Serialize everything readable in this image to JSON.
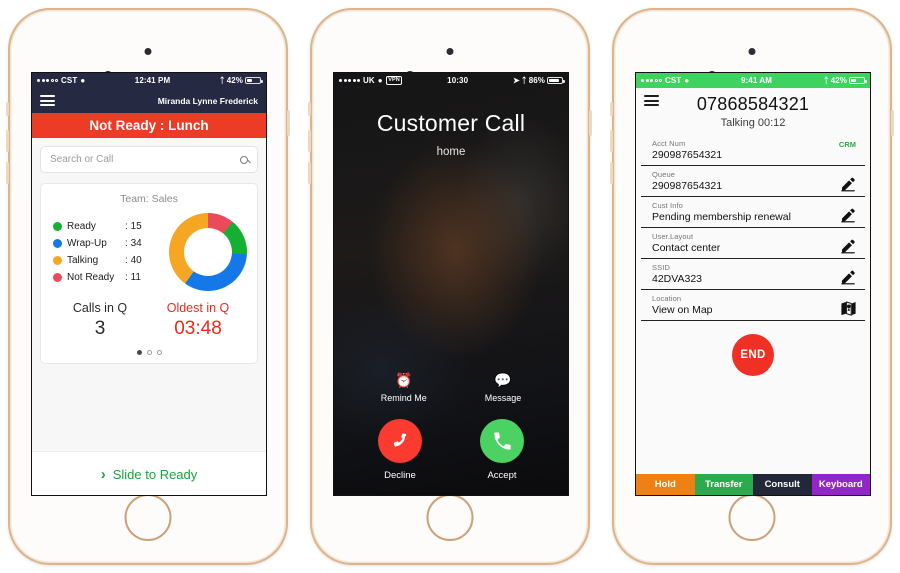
{
  "phone1": {
    "status_bar": {
      "carrier": "CST",
      "time": "12:41 PM",
      "battery": "42%",
      "wifi_icon": "wifi-icon",
      "bluetooth_icon": "bluetooth-icon"
    },
    "nav": {
      "menu_icon": "hamburger-menu-icon",
      "agent_name": "Miranda Lynne Frederick"
    },
    "state_bar": {
      "label": "Not Ready : Lunch",
      "color": "#ec3c26"
    },
    "search": {
      "placeholder": "Search or Call",
      "value": "",
      "icon": "search-icon"
    },
    "card": {
      "title": "Team: Sales"
    },
    "queue": {
      "calls_label": "Calls in Q",
      "calls_value": "3",
      "oldest_label": "Oldest in Q",
      "oldest_value": "03:48",
      "oldest_color": "#ec2a1a"
    },
    "pager": {
      "count": 3,
      "active": 0
    },
    "slide": {
      "label": "Slide to Ready",
      "chevron": "chevron-right-icon",
      "color": "#1aa33c"
    },
    "chart_data": {
      "type": "pie",
      "title": "Team: Sales",
      "categories": [
        "Ready",
        "Wrap-Up",
        "Talking",
        "Not Ready"
      ],
      "values": [
        15,
        34,
        40,
        11
      ],
      "colors": [
        "#13b033",
        "#1478e8",
        "#f5a623",
        "#ea4a5a"
      ],
      "total": 100,
      "legend": "left",
      "donut": true,
      "xlabel": "",
      "ylabel": ""
    }
  },
  "phone2": {
    "status_bar": {
      "carrier": "UK",
      "time": "10:30",
      "battery": "86%",
      "vpn": "VPN",
      "wifi_icon": "wifi-icon",
      "location_icon": "location-arrow-icon",
      "bluetooth_icon": "bluetooth-icon"
    },
    "title": "Customer Call",
    "subtitle": "home",
    "actions": [
      {
        "label": "Remind Me",
        "icon": "alarm-clock-icon"
      },
      {
        "label": "Message",
        "icon": "speech-bubble-icon"
      }
    ],
    "decline": {
      "label": "Decline",
      "icon": "phone-down-icon",
      "color": "#fb3b30"
    },
    "accept": {
      "label": "Accept",
      "icon": "phone-up-icon",
      "color": "#4cd263"
    }
  },
  "phone3": {
    "status_bar": {
      "carrier": "CST",
      "time": "9:41 AM",
      "battery": "42%",
      "wifi_icon": "wifi-icon",
      "bluetooth_icon": "bluetooth-icon",
      "color": "#3ed35f"
    },
    "menu_icon": "hamburger-menu-icon",
    "number": "07868584321",
    "call_status": "Talking 00:12",
    "fields": [
      {
        "label": "Acct Num",
        "value": "290987654321",
        "badge": "CRM",
        "icon": ""
      },
      {
        "label": "Queue",
        "value": "290987654321",
        "badge": "",
        "icon": "pencil-icon"
      },
      {
        "label": "Cust Info",
        "value": "Pending membership renewal",
        "badge": "",
        "icon": "pencil-icon"
      },
      {
        "label": "User.Layout",
        "value": "Contact center",
        "badge": "",
        "icon": "pencil-icon"
      },
      {
        "label": "SSID",
        "value": "42DVA323",
        "badge": "",
        "icon": "pencil-icon"
      },
      {
        "label": "Location",
        "value": "View on Map",
        "badge": "",
        "icon": "map-icon"
      }
    ],
    "end_button": {
      "label": "END",
      "color": "#f03024"
    },
    "toolbar": [
      {
        "label": "Hold",
        "color": "#ee8014"
      },
      {
        "label": "Transfer",
        "color": "#2eaa4e"
      },
      {
        "label": "Consult",
        "color": "#232838"
      },
      {
        "label": "Keyboard",
        "color": "#9426c9"
      }
    ]
  }
}
